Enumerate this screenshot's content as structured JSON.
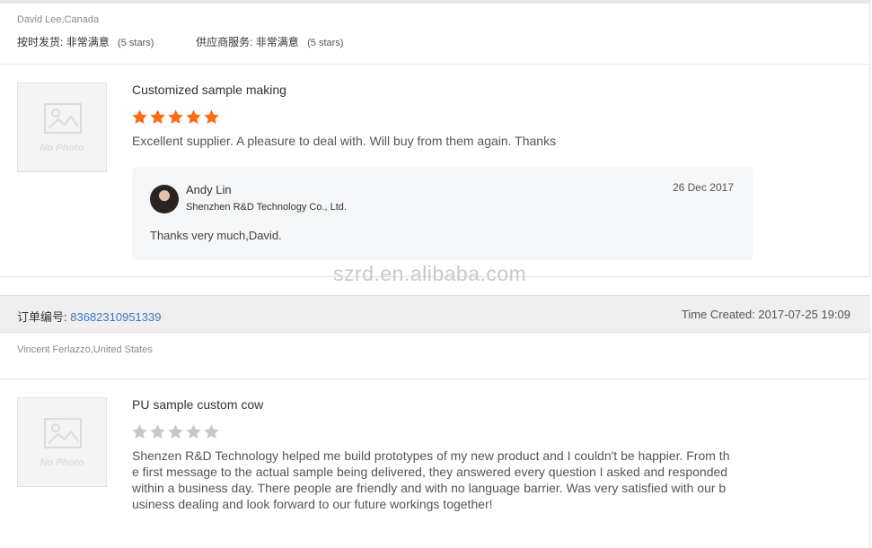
{
  "watermark": "szrd.en.alibaba.com",
  "review1": {
    "buyer": "David Lee,Canada",
    "delivery_label": "按时发货:",
    "delivery_value": "非常满意",
    "delivery_stars": "(5 stars)",
    "service_label": "供应商服务:",
    "service_value": "非常满意",
    "service_stars": "(5 stars)",
    "no_photo": "No Photo",
    "product": "Customized sample making",
    "rating": 5,
    "text": "Excellent supplier. A pleasure to deal with. Will buy from them again. Thanks",
    "reply": {
      "name": "Andy Lin",
      "company": "Shenzhen R&D Technology Co., Ltd.",
      "date": "26 Dec 2017",
      "text": "Thanks very much,David."
    }
  },
  "review2": {
    "order_label": "订单编号:",
    "order_number": "83682310951339",
    "time_created": "Time Created: 2017-07-25 19:09",
    "buyer": "Vincent Ferlazzo,United States",
    "no_photo": "No Photo",
    "product": "PU sample custom cow",
    "rating": 0,
    "text_lines": [
      "Shenzen R&D Technology helped me build prototypes of my new product and I couldn't be happier. From th",
      "e first message to the actual sample being delivered, they answered every question I asked and responded",
      "within a business day. There people are friendly and with no language barrier. Was very satisfied with our b",
      "usiness dealing and look forward to our future workings together!"
    ]
  },
  "colors": {
    "star_filled": "#ff6a14",
    "star_empty": "#c7c7c7",
    "link": "#3b77c6"
  }
}
